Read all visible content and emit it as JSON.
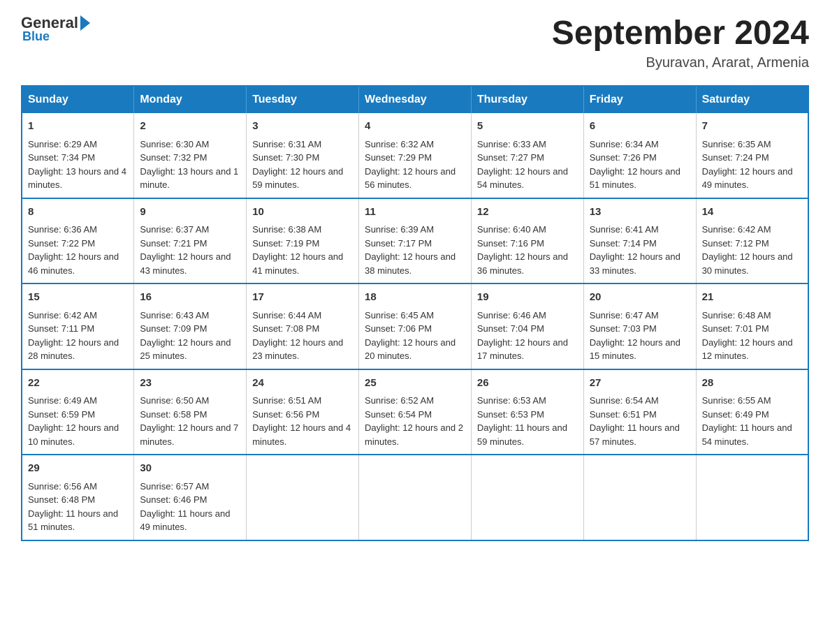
{
  "logo": {
    "general": "General",
    "blue": "Blue"
  },
  "title": "September 2024",
  "subtitle": "Byuravan, Ararat, Armenia",
  "days_header": [
    "Sunday",
    "Monday",
    "Tuesday",
    "Wednesday",
    "Thursday",
    "Friday",
    "Saturday"
  ],
  "weeks": [
    [
      {
        "day": "1",
        "sunrise": "6:29 AM",
        "sunset": "7:34 PM",
        "daylight": "13 hours and 4 minutes."
      },
      {
        "day": "2",
        "sunrise": "6:30 AM",
        "sunset": "7:32 PM",
        "daylight": "13 hours and 1 minute."
      },
      {
        "day": "3",
        "sunrise": "6:31 AM",
        "sunset": "7:30 PM",
        "daylight": "12 hours and 59 minutes."
      },
      {
        "day": "4",
        "sunrise": "6:32 AM",
        "sunset": "7:29 PM",
        "daylight": "12 hours and 56 minutes."
      },
      {
        "day": "5",
        "sunrise": "6:33 AM",
        "sunset": "7:27 PM",
        "daylight": "12 hours and 54 minutes."
      },
      {
        "day": "6",
        "sunrise": "6:34 AM",
        "sunset": "7:26 PM",
        "daylight": "12 hours and 51 minutes."
      },
      {
        "day": "7",
        "sunrise": "6:35 AM",
        "sunset": "7:24 PM",
        "daylight": "12 hours and 49 minutes."
      }
    ],
    [
      {
        "day": "8",
        "sunrise": "6:36 AM",
        "sunset": "7:22 PM",
        "daylight": "12 hours and 46 minutes."
      },
      {
        "day": "9",
        "sunrise": "6:37 AM",
        "sunset": "7:21 PM",
        "daylight": "12 hours and 43 minutes."
      },
      {
        "day": "10",
        "sunrise": "6:38 AM",
        "sunset": "7:19 PM",
        "daylight": "12 hours and 41 minutes."
      },
      {
        "day": "11",
        "sunrise": "6:39 AM",
        "sunset": "7:17 PM",
        "daylight": "12 hours and 38 minutes."
      },
      {
        "day": "12",
        "sunrise": "6:40 AM",
        "sunset": "7:16 PM",
        "daylight": "12 hours and 36 minutes."
      },
      {
        "day": "13",
        "sunrise": "6:41 AM",
        "sunset": "7:14 PM",
        "daylight": "12 hours and 33 minutes."
      },
      {
        "day": "14",
        "sunrise": "6:42 AM",
        "sunset": "7:12 PM",
        "daylight": "12 hours and 30 minutes."
      }
    ],
    [
      {
        "day": "15",
        "sunrise": "6:42 AM",
        "sunset": "7:11 PM",
        "daylight": "12 hours and 28 minutes."
      },
      {
        "day": "16",
        "sunrise": "6:43 AM",
        "sunset": "7:09 PM",
        "daylight": "12 hours and 25 minutes."
      },
      {
        "day": "17",
        "sunrise": "6:44 AM",
        "sunset": "7:08 PM",
        "daylight": "12 hours and 23 minutes."
      },
      {
        "day": "18",
        "sunrise": "6:45 AM",
        "sunset": "7:06 PM",
        "daylight": "12 hours and 20 minutes."
      },
      {
        "day": "19",
        "sunrise": "6:46 AM",
        "sunset": "7:04 PM",
        "daylight": "12 hours and 17 minutes."
      },
      {
        "day": "20",
        "sunrise": "6:47 AM",
        "sunset": "7:03 PM",
        "daylight": "12 hours and 15 minutes."
      },
      {
        "day": "21",
        "sunrise": "6:48 AM",
        "sunset": "7:01 PM",
        "daylight": "12 hours and 12 minutes."
      }
    ],
    [
      {
        "day": "22",
        "sunrise": "6:49 AM",
        "sunset": "6:59 PM",
        "daylight": "12 hours and 10 minutes."
      },
      {
        "day": "23",
        "sunrise": "6:50 AM",
        "sunset": "6:58 PM",
        "daylight": "12 hours and 7 minutes."
      },
      {
        "day": "24",
        "sunrise": "6:51 AM",
        "sunset": "6:56 PM",
        "daylight": "12 hours and 4 minutes."
      },
      {
        "day": "25",
        "sunrise": "6:52 AM",
        "sunset": "6:54 PM",
        "daylight": "12 hours and 2 minutes."
      },
      {
        "day": "26",
        "sunrise": "6:53 AM",
        "sunset": "6:53 PM",
        "daylight": "11 hours and 59 minutes."
      },
      {
        "day": "27",
        "sunrise": "6:54 AM",
        "sunset": "6:51 PM",
        "daylight": "11 hours and 57 minutes."
      },
      {
        "day": "28",
        "sunrise": "6:55 AM",
        "sunset": "6:49 PM",
        "daylight": "11 hours and 54 minutes."
      }
    ],
    [
      {
        "day": "29",
        "sunrise": "6:56 AM",
        "sunset": "6:48 PM",
        "daylight": "11 hours and 51 minutes."
      },
      {
        "day": "30",
        "sunrise": "6:57 AM",
        "sunset": "6:46 PM",
        "daylight": "11 hours and 49 minutes."
      },
      null,
      null,
      null,
      null,
      null
    ]
  ]
}
